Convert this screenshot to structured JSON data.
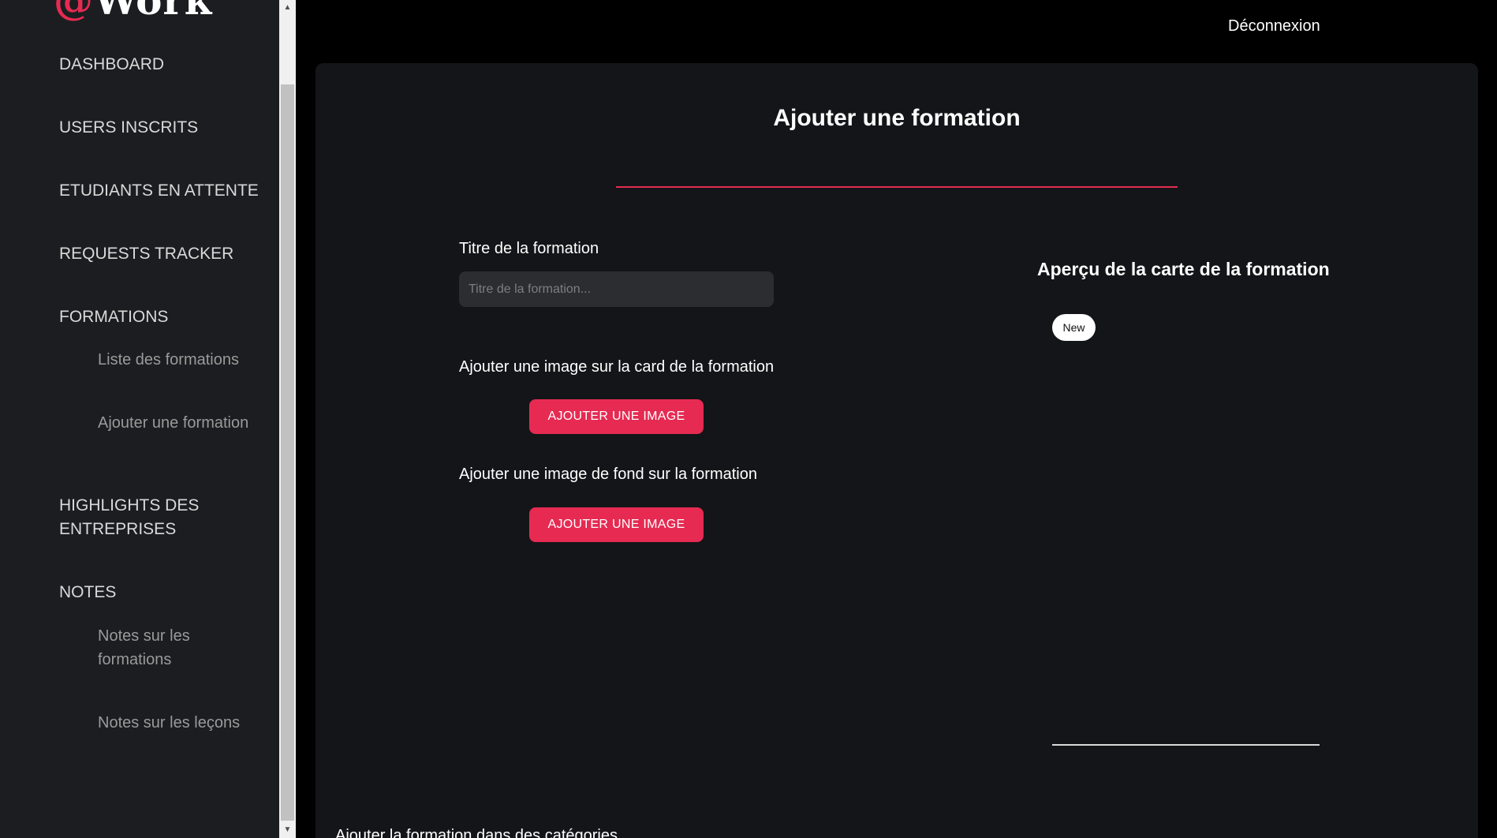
{
  "sidebar": {
    "logo": {
      "at": "@",
      "rest": "Work"
    },
    "items": [
      {
        "label": "DASHBOARD"
      },
      {
        "label": "USERS INSCRITS"
      },
      {
        "label": "ETUDIANTS EN ATTENTE"
      },
      {
        "label": "REQUESTS TRACKER"
      },
      {
        "label": "FORMATIONS"
      },
      {
        "label": "Liste des formations"
      },
      {
        "label": "Ajouter une formation"
      },
      {
        "label": "HIGHLIGHTS DES"
      },
      {
        "label": "ENTREPRISES"
      },
      {
        "label": "NOTES"
      },
      {
        "label": "Notes sur les"
      },
      {
        "label": "formations"
      },
      {
        "label": "Notes sur les leçons"
      }
    ]
  },
  "header": {
    "logout_label": "Déconnexion"
  },
  "main": {
    "title": "Ajouter une formation",
    "title_field": {
      "label": "Titre de la formation",
      "placeholder": "Titre de la formation...",
      "value": ""
    },
    "card_image": {
      "label": "Ajouter une image sur la card de la formation",
      "button": "AJOUTER UNE IMAGE"
    },
    "background_image": {
      "label": "Ajouter une image de fond sur la formation",
      "button": "AJOUTER UNE IMAGE"
    },
    "preview": {
      "title": "Aperçu de la carte de la formation",
      "badge": "New"
    },
    "categories_label": "Ajouter la formation dans des catégories"
  },
  "colors": {
    "accent": "#e62a52",
    "sidebar_bg": "#1c1d20",
    "panel_bg": "#141518",
    "page_bg": "#000000"
  }
}
